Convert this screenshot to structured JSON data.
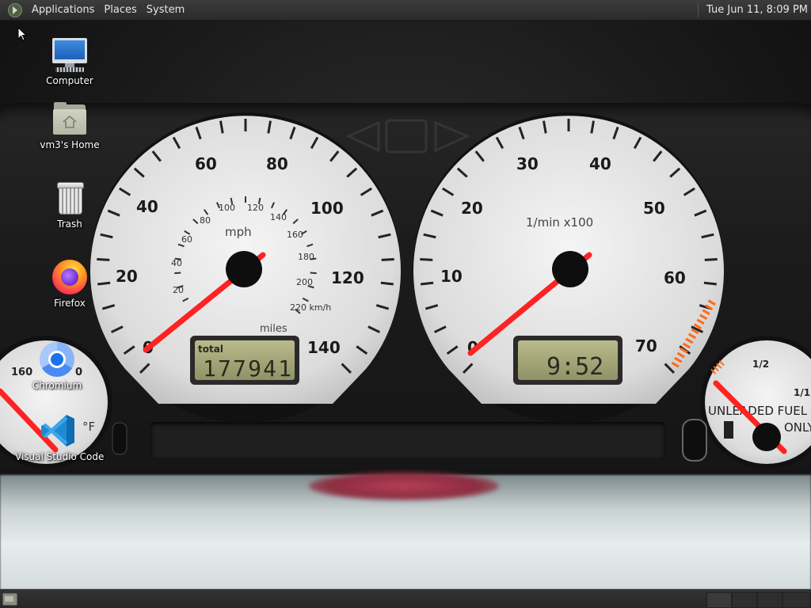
{
  "top_panel": {
    "menus": [
      "Applications",
      "Places",
      "System"
    ],
    "clock": "Tue Jun 11,  8:09 PM",
    "logo_icon": "distro-menu-icon"
  },
  "desktop_icons": [
    {
      "label": "Computer",
      "icon": "computer-icon"
    },
    {
      "label": "vm3's Home",
      "icon": "home-folder-icon"
    },
    {
      "label": "Trash",
      "icon": "trash-icon"
    },
    {
      "label": "Firefox",
      "icon": "firefox-icon"
    },
    {
      "label": "Chromium",
      "icon": "chromium-icon"
    },
    {
      "label": "Visual Studio Code",
      "icon": "vscode-icon"
    }
  ],
  "wallpaper": {
    "speedometer": {
      "outer_ticks": [
        "20",
        "40",
        "60",
        "80",
        "100",
        "120",
        "140"
      ],
      "inner_ticks": [
        "20",
        "40",
        "60",
        "80",
        "100",
        "120",
        "140",
        "160",
        "180",
        "200"
      ],
      "unit": "mph",
      "inner_unit": "220 km/h",
      "odometer_label": "total",
      "odometer_unit": "miles",
      "odometer_value": "177941",
      "zero": "0"
    },
    "tachometer": {
      "ticks": [
        "10",
        "20",
        "30",
        "40",
        "50",
        "60",
        "70"
      ],
      "zero": "0",
      "unit": "1/min x100",
      "clock_value": "9:52"
    },
    "fuel_gauge": {
      "label_half": "1/2",
      "label_full": "1/1",
      "text_line1": "UNLEADED FUEL",
      "text_line2": "ONLY"
    },
    "temp_gauge": {
      "tick": "160",
      "tick2": "0",
      "unit": "°F"
    }
  },
  "colors": {
    "needle": "#ff2222",
    "gauge_face": "#e4e4e4",
    "lcd": "#a5a77a",
    "panel": "#2d2d2d"
  }
}
